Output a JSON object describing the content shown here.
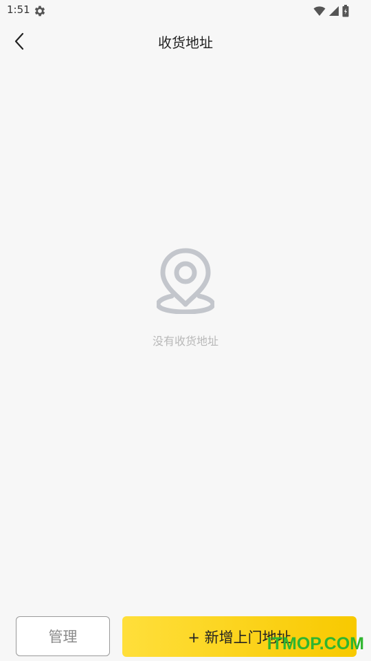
{
  "status_bar": {
    "time": "1:51",
    "icons": [
      "gear-icon",
      "wifi-icon",
      "signal-icon",
      "battery-icon"
    ]
  },
  "header": {
    "title": "收货地址",
    "back_icon": "chevron-left-icon"
  },
  "empty_state": {
    "icon": "location-pin-icon",
    "message": "没有收货地址"
  },
  "actions": {
    "manage_label": "管理",
    "add_label": "+ 新增上门地址"
  },
  "watermark": {
    "text": "ITMOP.COM"
  },
  "colors": {
    "background": "#f7f7f7",
    "accent_start": "#ffdf3b",
    "accent_end": "#f8c900",
    "muted_text": "#b8b8b8",
    "icon_gray": "#c3c6cc",
    "watermark": "#2fb52f"
  }
}
